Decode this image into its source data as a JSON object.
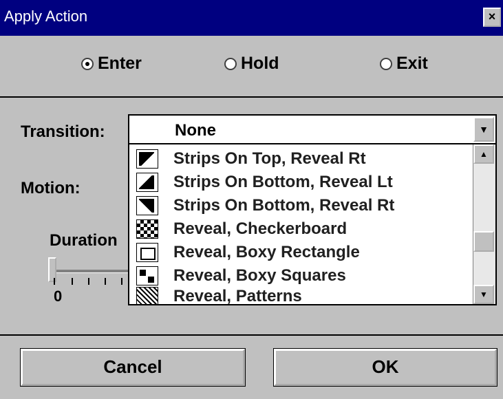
{
  "window": {
    "title": "Apply Action",
    "close_glyph": "×"
  },
  "phase_radios": [
    {
      "label": "Enter",
      "selected": true
    },
    {
      "label": "Hold",
      "selected": false
    },
    {
      "label": "Exit",
      "selected": false
    }
  ],
  "transition": {
    "label": "Transition:",
    "selected_value": "None",
    "options": [
      {
        "label": "Strips On Top, Reveal Rt",
        "icon": "strips-top-icon"
      },
      {
        "label": "Strips On Bottom, Reveal Lt",
        "icon": "strips-bottom-left-icon"
      },
      {
        "label": "Strips On Bottom, Reveal Rt",
        "icon": "strips-bottom-right-icon"
      },
      {
        "label": "Reveal, Checkerboard",
        "icon": "checkerboard-icon"
      },
      {
        "label": "Reveal, Boxy Rectangle",
        "icon": "boxy-rectangle-icon"
      },
      {
        "label": "Reveal, Boxy Squares",
        "icon": "boxy-squares-icon"
      },
      {
        "label": "Reveal, Patterns",
        "icon": "patterns-icon"
      }
    ]
  },
  "motion": {
    "label": "Motion:"
  },
  "duration": {
    "label": "Duration",
    "value": "0"
  },
  "buttons": {
    "cancel": "Cancel",
    "ok": "OK"
  },
  "colors": {
    "titlebar": "#000080",
    "face": "#c0c0c0",
    "list_bg": "#ffffff"
  }
}
